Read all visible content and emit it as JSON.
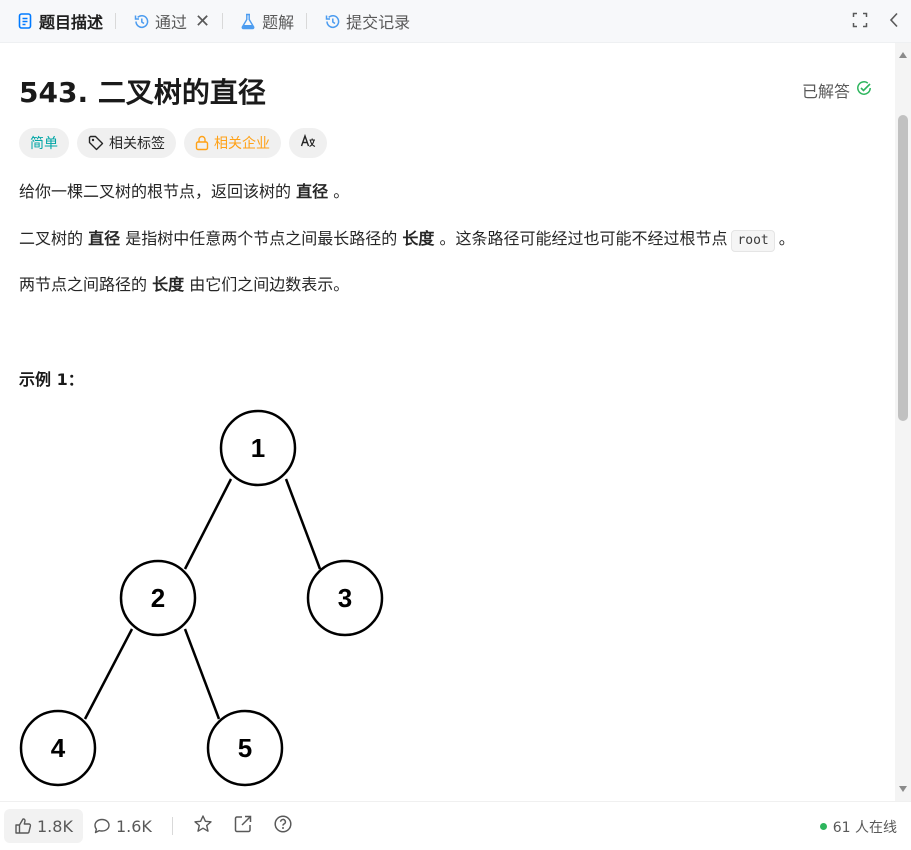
{
  "tabs": [
    {
      "label": "题目描述",
      "icon": "document-icon",
      "active": true
    },
    {
      "label": "通过",
      "icon": "history-icon",
      "closable": true
    },
    {
      "label": "题解",
      "icon": "flask-icon"
    },
    {
      "label": "提交记录",
      "icon": "history-icon"
    }
  ],
  "problem": {
    "title": "543. 二叉树的直径",
    "status": "已解答",
    "tags": [
      "简单",
      "相关标签",
      "相关企业",
      "A文"
    ],
    "p1": {
      "before": "给你一棵二叉树的根节点，返回该树的",
      "bold": "直径",
      "after": "。"
    },
    "p2": {
      "before": "二叉树的",
      "bold1": "直径",
      "mid": "是指树中任意两个节点之间最长路径的",
      "bold2": "长度",
      "after": "。这条路径可能经过也可能不经过根节点",
      "code": "root",
      "end": "。"
    },
    "p3": {
      "before": "两节点之间路径的",
      "bold": "长度",
      "after": "由它们之间边数表示。"
    },
    "example_heading": "示例 1：",
    "tree_nodes": [
      "1",
      "2",
      "3",
      "4",
      "5"
    ]
  },
  "footer": {
    "likes": "1.8K",
    "comments": "1.6K",
    "online": "61 人在线"
  },
  "colors": {
    "accent": "#007aff",
    "easy": "#00a6a6",
    "company": "#ffa116",
    "solved": "#2db55d"
  }
}
